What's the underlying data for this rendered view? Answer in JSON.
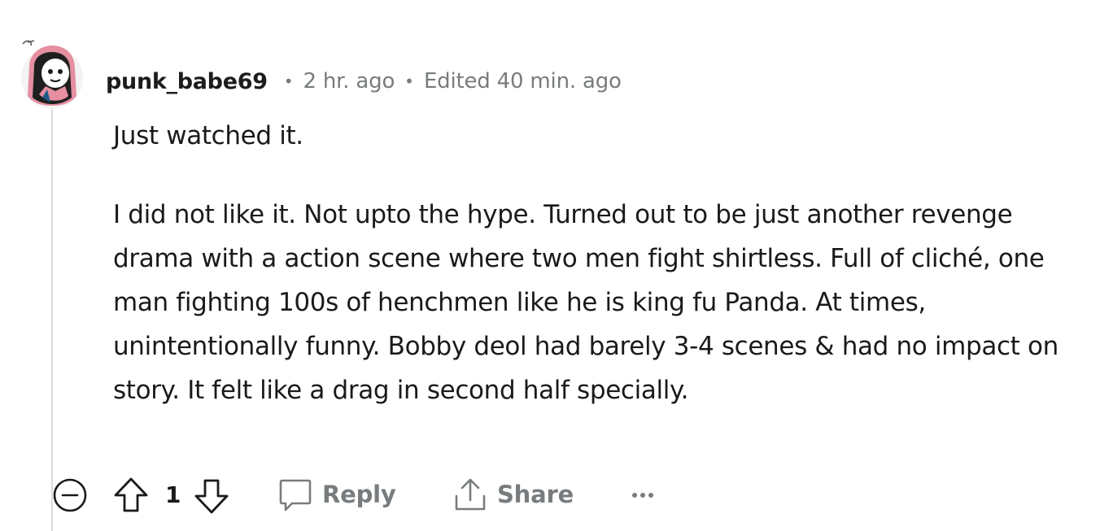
{
  "comment": {
    "author": "punk_babe69",
    "posted": "2 hr. ago",
    "edited": "Edited 40 min. ago",
    "separator": "•",
    "paragraphs": [
      "Just watched it.",
      "I did not like it. Not upto the hype. Turned out to be just another revenge drama with a action scene where two men fight shirtless. Full of cliché, one man fighting 100s of henchmen like he is king fu Panda. At times, unintentionally funny. Bobby deol had barely 3-4 scenes & had no impact on story. It felt like a drag in second half specially."
    ],
    "avatar": {
      "icon": "avatar-icon",
      "hood_color": "#e58fa1",
      "face_color": "#ffffff"
    }
  },
  "actions": {
    "vote_count": "1",
    "reply_label": "Reply",
    "share_label": "Share",
    "icons": {
      "collapse": "collapse-icon",
      "upvote": "upvote-icon",
      "downvote": "downvote-icon",
      "reply": "reply-icon",
      "share": "share-icon",
      "more": "more-icon"
    }
  },
  "colors": {
    "text": "#1a1a1b",
    "muted": "#787c7e",
    "thread_line": "#dadcde"
  }
}
